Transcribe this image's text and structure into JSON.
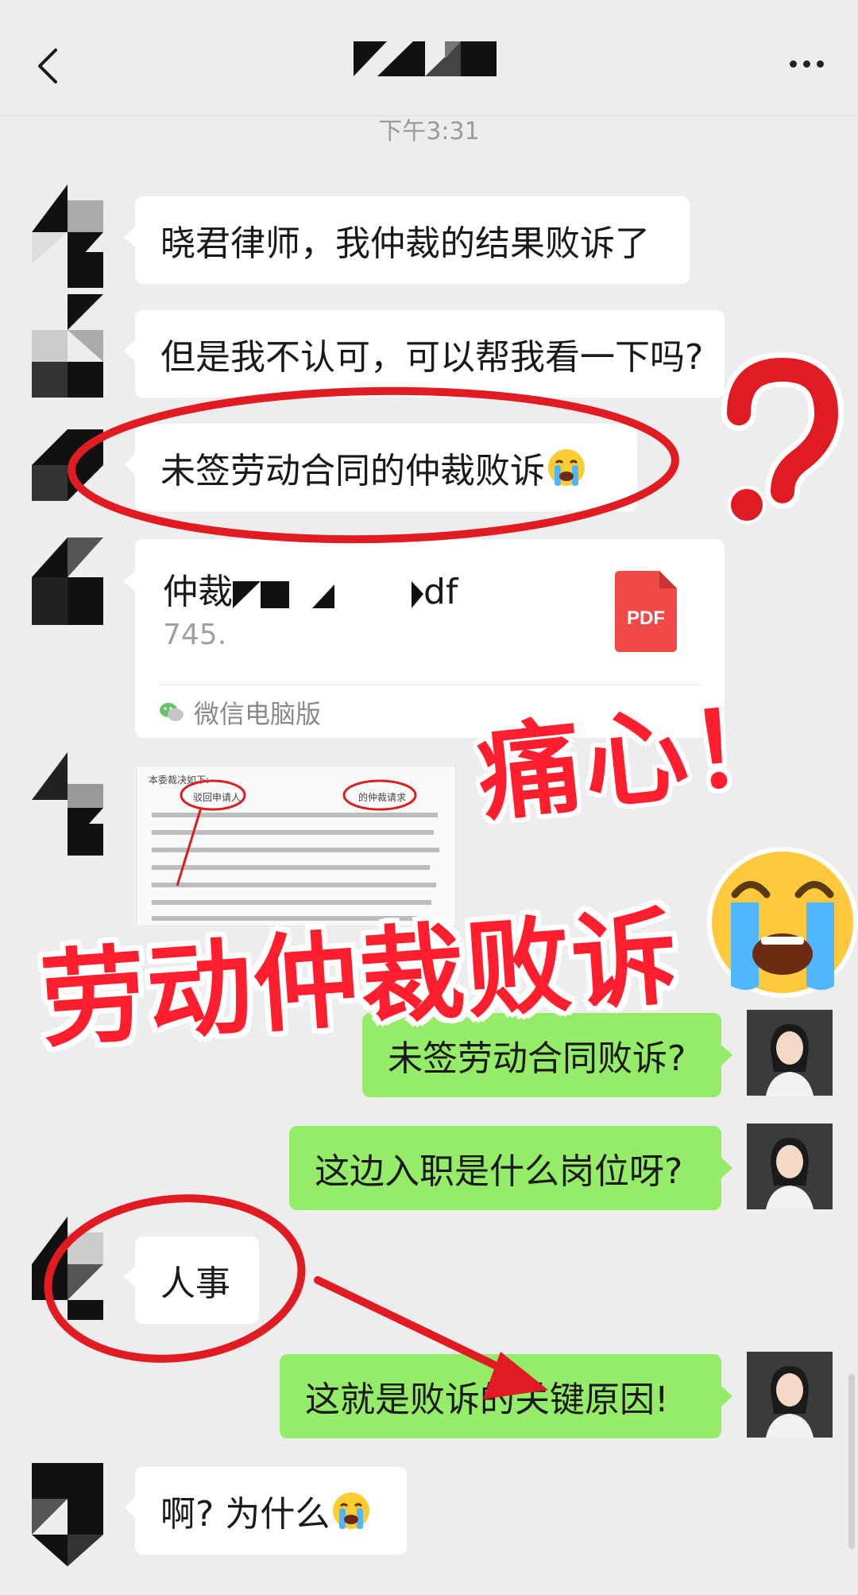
{
  "header": {
    "back_icon": "chevron-left-icon",
    "more_icon": "more-dots-icon"
  },
  "timestamp": "下午3:31",
  "messages": {
    "m1": "晓君律师，我仲裁的结果败诉了",
    "m2": "但是我不认可，可以帮我看一下吗?",
    "m3": "未签劳动合同的仲裁败诉",
    "m4_file": {
      "name_prefix": "仲裁",
      "name_suffix": "df",
      "size": "745.",
      "source": "微信电脑版"
    },
    "m6": "未签劳动合同败诉?",
    "m7": "这边入职是什么岗位呀?",
    "m8": "人事",
    "m9": "这就是败诉的关键原因!",
    "m10": "啊? 为什么"
  },
  "pdf_label": "PDF",
  "doc_image_text": {
    "line1": "本委裁决如下:",
    "highlight_left": "驳回申请人",
    "highlight_right": "的仲裁请求"
  },
  "overlay": {
    "pain_text": "痛心！",
    "title_text": "劳动仲裁败诉",
    "question_mark": "?"
  },
  "colors": {
    "incoming_bubble": "#ffffff",
    "outgoing_bubble": "#95ec69",
    "accent_red": "#ff1e2d",
    "background": "#ededed"
  }
}
